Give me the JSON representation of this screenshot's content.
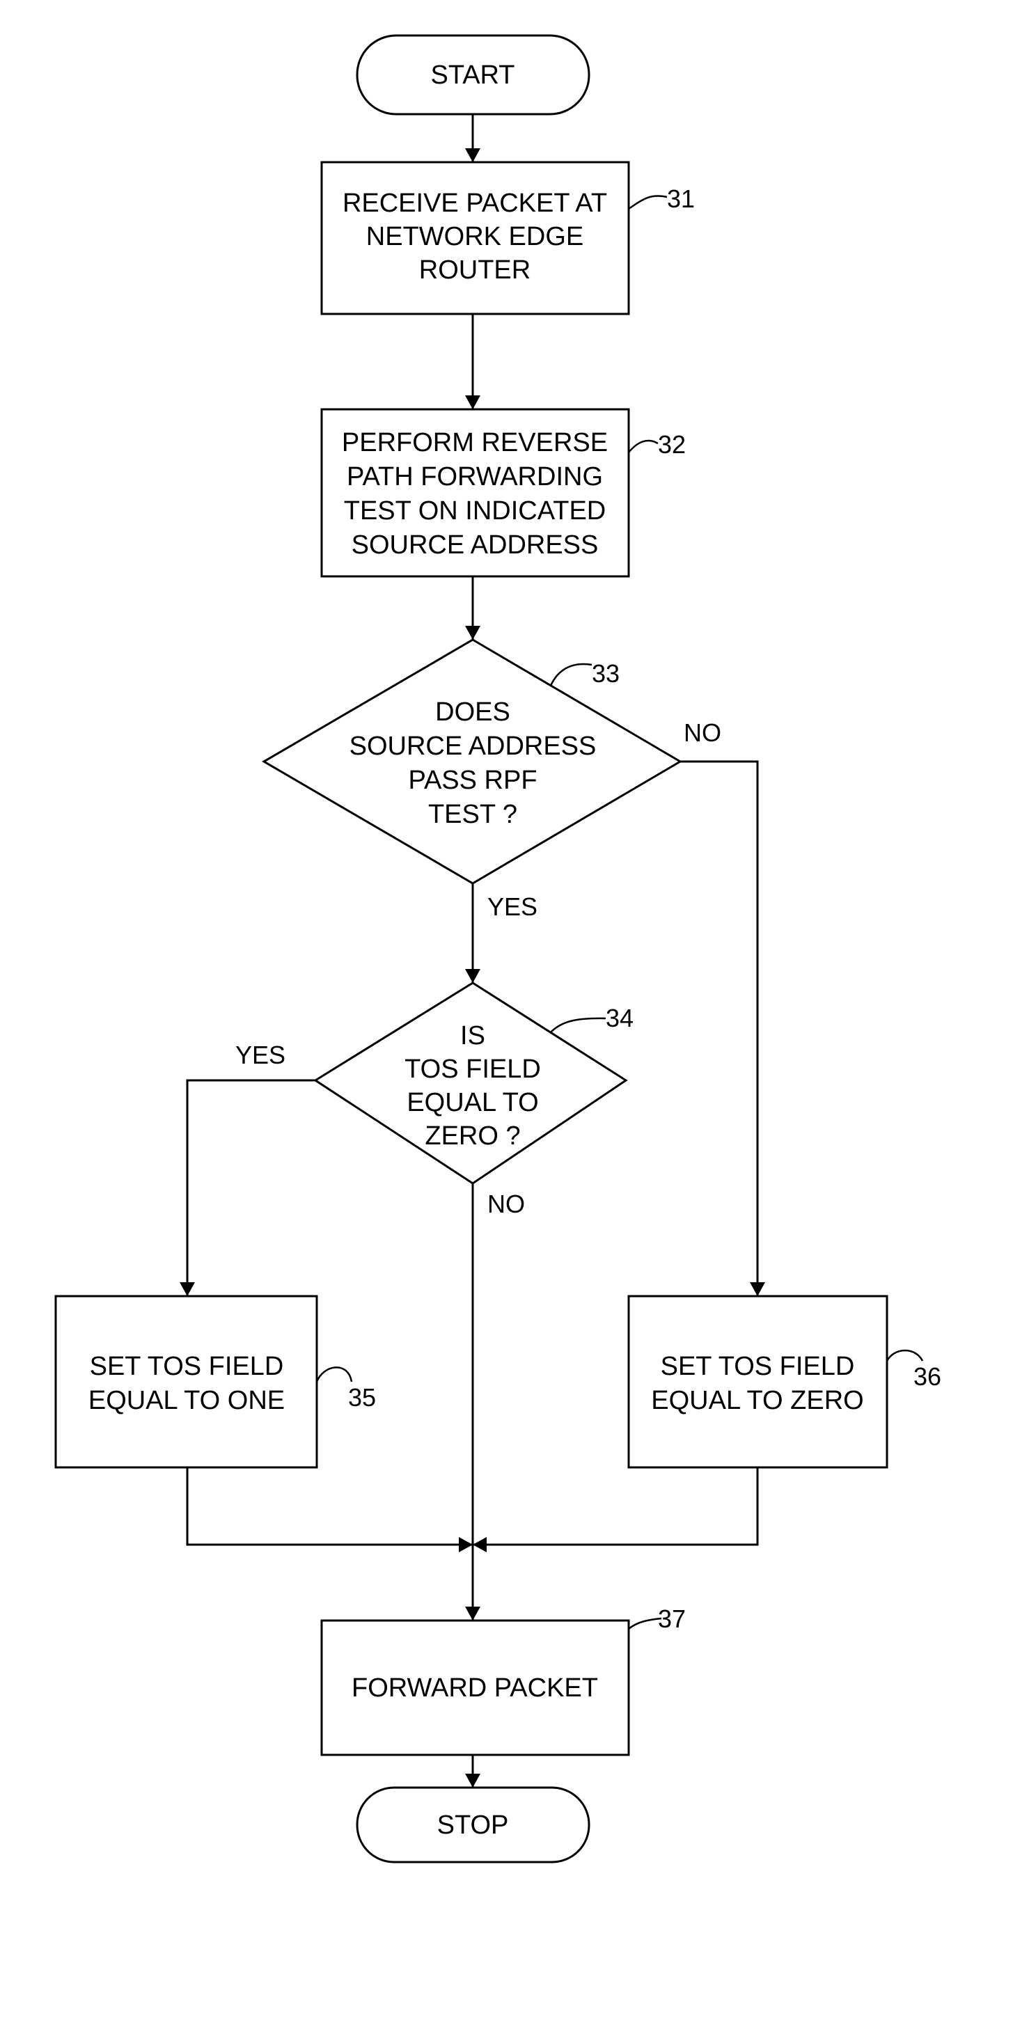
{
  "diagram": {
    "type": "flowchart",
    "nodes": {
      "start": {
        "label": "START"
      },
      "n31": {
        "ref": "31",
        "lines": [
          "RECEIVE PACKET AT",
          "NETWORK EDGE",
          "ROUTER"
        ]
      },
      "n32": {
        "ref": "32",
        "lines": [
          "PERFORM REVERSE",
          "PATH FORWARDING",
          "TEST ON INDICATED",
          "SOURCE ADDRESS"
        ]
      },
      "n33": {
        "ref": "33",
        "lines": [
          "DOES",
          "SOURCE ADDRESS",
          "PASS RPF",
          "TEST ?"
        ]
      },
      "n34": {
        "ref": "34",
        "lines": [
          "IS",
          "TOS FIELD",
          "EQUAL TO",
          "ZERO ?"
        ]
      },
      "n35": {
        "ref": "35",
        "lines": [
          "SET TOS FIELD",
          "EQUAL TO ONE"
        ]
      },
      "n36": {
        "ref": "36",
        "lines": [
          "SET TOS FIELD",
          "EQUAL TO ZERO"
        ]
      },
      "n37": {
        "ref": "37",
        "lines": [
          "FORWARD PACKET"
        ]
      },
      "stop": {
        "label": "STOP"
      }
    },
    "edge_labels": {
      "n33_no": "NO",
      "n33_yes": "YES",
      "n34_yes": "YES",
      "n34_no": "NO"
    },
    "edges": [
      [
        "start",
        "n31"
      ],
      [
        "n31",
        "n32"
      ],
      [
        "n32",
        "n33"
      ],
      [
        "n33",
        "n34",
        "YES"
      ],
      [
        "n33",
        "n36",
        "NO"
      ],
      [
        "n34",
        "n35",
        "YES"
      ],
      [
        "n34",
        "n37",
        "NO"
      ],
      [
        "n35",
        "n37"
      ],
      [
        "n36",
        "n37"
      ],
      [
        "n37",
        "stop"
      ]
    ]
  }
}
